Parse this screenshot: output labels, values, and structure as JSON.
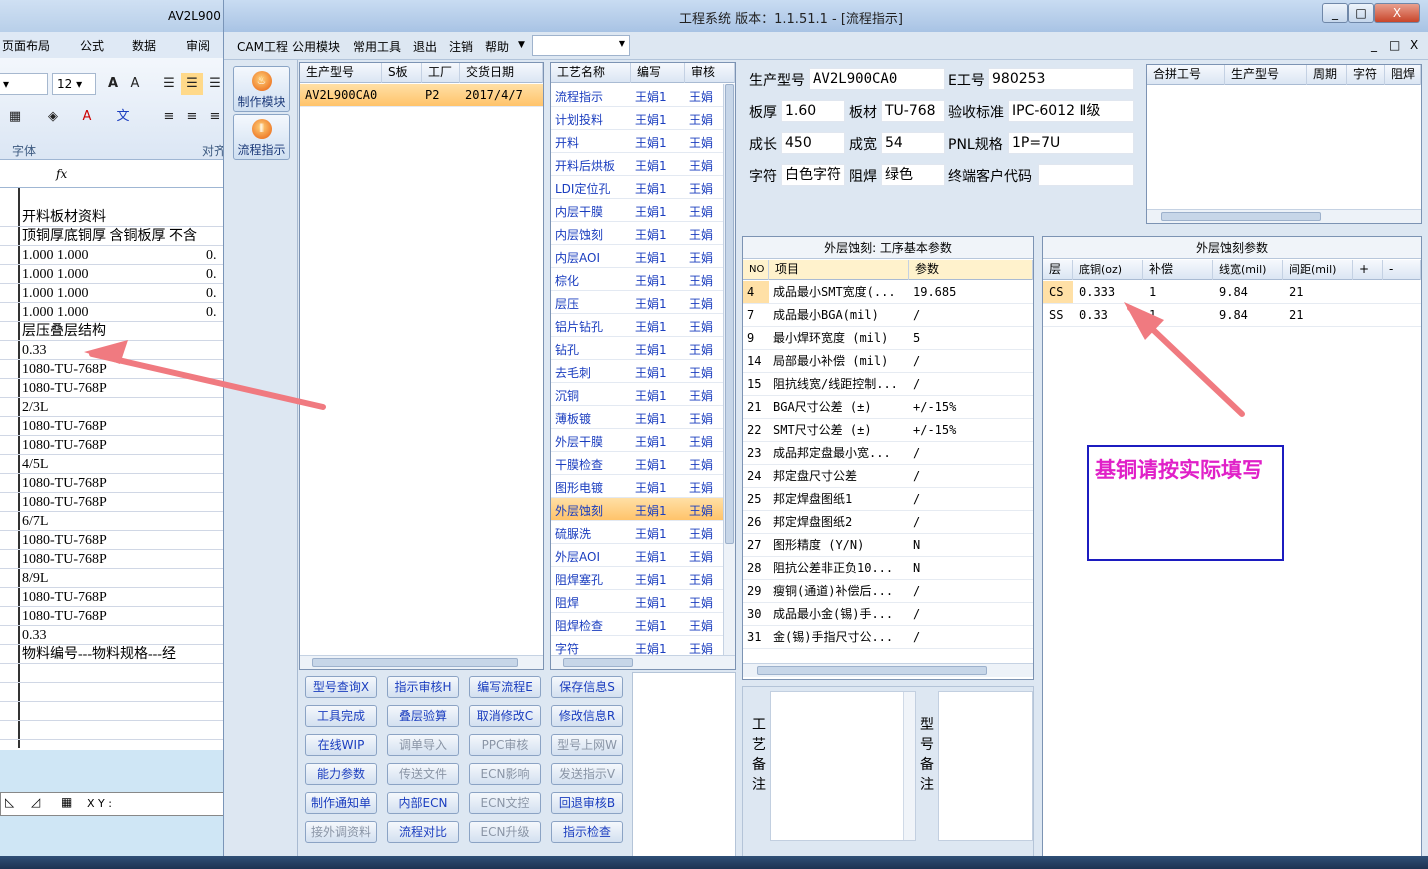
{
  "excel": {
    "title": "AV2L900",
    "tabs": [
      "页面布局",
      "公式",
      "数据",
      "审阅"
    ],
    "font_size": "12",
    "font_group": "字体",
    "align_group": "对齐",
    "fx": "fx",
    "rows": [
      "开料板材资料",
      "顶铜厚底铜厚 含铜板厚 不含",
      "1.000  1.000",
      "1.000  1.000",
      "1.000  1.000",
      "1.000  1.000",
      "层压叠层结构",
      "0.33",
      "1080-TU-768P",
      "1080-TU-768P",
      "2/3L",
      "1080-TU-768P",
      "1080-TU-768P",
      "4/5L",
      "1080-TU-768P",
      "1080-TU-768P",
      "6/7L",
      "1080-TU-768P",
      "1080-TU-768P",
      "8/9L",
      "1080-TU-768P",
      "1080-TU-768P",
      "0.33",
      "物料编号---物料规格---经"
    ],
    "row_suffix": [
      "",
      "",
      "0.",
      "0.",
      "0.",
      "0.",
      "",
      "",
      "",
      "",
      "",
      "",
      "",
      "",
      "",
      "",
      "",
      "",
      "",
      "",
      "",
      "",
      "",
      ""
    ],
    "xy_label": "X Y :"
  },
  "window": {
    "title": "工程系统   版本：1.1.51.1 - [流程指示]",
    "menus": [
      "CAM工程",
      "公用模块",
      "常用工具",
      "退出",
      "注销",
      "帮助"
    ],
    "min": "_",
    "restore": "□",
    "close": "X",
    "child_min": "_",
    "child_restore": "□",
    "child_close": "X"
  },
  "side_buttons": [
    {
      "label": "制作模块"
    },
    {
      "label": "流程指示"
    }
  ],
  "orders": {
    "headers": [
      "生产型号",
      "S板",
      "工厂",
      "交货日期"
    ],
    "rows": [
      {
        "model": "AV2L900CA0",
        "s": "",
        "factory": "P2",
        "date": "2017/4/7"
      }
    ]
  },
  "processes": {
    "headers": [
      "工艺名称",
      "编写",
      "审核"
    ],
    "rows": [
      [
        "流程指示",
        "王娟1",
        "王娟"
      ],
      [
        "计划投料",
        "王娟1",
        "王娟"
      ],
      [
        "开料",
        "王娟1",
        "王娟"
      ],
      [
        "开料后烘板",
        "王娟1",
        "王娟"
      ],
      [
        "LDI定位孔",
        "王娟1",
        "王娟"
      ],
      [
        "内层干膜",
        "王娟1",
        "王娟"
      ],
      [
        "内层蚀刻",
        "王娟1",
        "王娟"
      ],
      [
        "内层AOI",
        "王娟1",
        "王娟"
      ],
      [
        "棕化",
        "王娟1",
        "王娟"
      ],
      [
        "层压",
        "王娟1",
        "王娟"
      ],
      [
        "铝片钻孔",
        "王娟1",
        "王娟"
      ],
      [
        "钻孔",
        "王娟1",
        "王娟"
      ],
      [
        "去毛刺",
        "王娟1",
        "王娟"
      ],
      [
        "沉铜",
        "王娟1",
        "王娟"
      ],
      [
        "薄板镀",
        "王娟1",
        "王娟"
      ],
      [
        "外层干膜",
        "王娟1",
        "王娟"
      ],
      [
        "干膜检查",
        "王娟1",
        "王娟"
      ],
      [
        "图形电镀",
        "王娟1",
        "王娟"
      ],
      [
        "外层蚀刻",
        "王娟1",
        "王娟"
      ],
      [
        "硫脲洗",
        "王娟1",
        "王娟"
      ],
      [
        "外层AOI",
        "王娟1",
        "王娟"
      ],
      [
        "阻焊塞孔",
        "王娟1",
        "王娟"
      ],
      [
        "阻焊",
        "王娟1",
        "王娟"
      ],
      [
        "阻焊检查",
        "王娟1",
        "王娟"
      ],
      [
        "字符",
        "王娟1",
        "王娟"
      ]
    ],
    "selected_index": 18
  },
  "info": {
    "model_label": "生产型号",
    "model": "AV2L900CA0",
    "e_label": "E工号",
    "e": "980253",
    "thick_label": "板厚",
    "thick": "1.60",
    "mat_label": "板材",
    "mat": "TU-768",
    "std_label": "验收标准",
    "std": "IPC-6012 Ⅱ级",
    "len_label": "成长",
    "len": "450",
    "wid_label": "成宽",
    "wid": "54",
    "pnl_label": "PNL规格",
    "pnl": "1P=7U",
    "char_label": "字符",
    "char": "白色字符",
    "mask_label": "阻焊",
    "mask": "绿色",
    "cust_label": "终端客户代码",
    "cust": ""
  },
  "merge": {
    "headers": [
      "合拼工号",
      "生产型号",
      "周期",
      "字符",
      "阻焊"
    ]
  },
  "basic_params": {
    "title": "外层蚀刻: 工序基本参数",
    "headers": [
      "NO",
      "项目",
      "参数"
    ],
    "rows": [
      [
        "4",
        "成品最小SMT宽度(...",
        "19.685"
      ],
      [
        "7",
        "成品最小BGA(mil)",
        "/"
      ],
      [
        "9",
        "最小焊环宽度 (mil)",
        "5"
      ],
      [
        "14",
        "局部最小补偿 (mil)",
        "/"
      ],
      [
        "15",
        "阻抗线宽/线距控制...",
        "/"
      ],
      [
        "21",
        "BGA尺寸公差 (±)",
        "+/-15%"
      ],
      [
        "22",
        "SMT尺寸公差 (±)",
        "+/-15%"
      ],
      [
        "23",
        "成品邦定盘最小宽...",
        "/"
      ],
      [
        "24",
        "邦定盘尺寸公差",
        "/"
      ],
      [
        "25",
        "邦定焊盘图纸1",
        "/"
      ],
      [
        "26",
        "邦定焊盘图纸2",
        "/"
      ],
      [
        "27",
        "图形精度 (Y/N)",
        "N"
      ],
      [
        "28",
        "阻抗公差非正负10...",
        "N"
      ],
      [
        "29",
        "瘦铜(通道)补偿后...",
        "/"
      ],
      [
        "30",
        "成品最小金(锡)手...",
        "/"
      ],
      [
        "31",
        "金(锡)手指尺寸公...",
        "/"
      ]
    ]
  },
  "etch_params": {
    "title": "外层蚀刻参数",
    "headers": [
      "层",
      "底铜(oz)",
      "补偿",
      "线宽(mil)",
      "间距(mil)",
      "+",
      "-"
    ],
    "rows": [
      [
        "CS",
        "0.333",
        "1",
        "9.84",
        "21"
      ],
      [
        "SS",
        "0.33",
        "1",
        "9.84",
        "21"
      ]
    ]
  },
  "buttons": [
    {
      "label": "型号查询X",
      "enabled": true
    },
    {
      "label": "指示审核H",
      "enabled": true
    },
    {
      "label": "编写流程E",
      "enabled": true
    },
    {
      "label": "保存信息S",
      "enabled": true
    },
    {
      "label": "工具完成",
      "enabled": true
    },
    {
      "label": "叠层验算",
      "enabled": true
    },
    {
      "label": "取消修改C",
      "enabled": true
    },
    {
      "label": "修改信息R",
      "enabled": true
    },
    {
      "label": "在线WIP",
      "enabled": true
    },
    {
      "label": "调单导入",
      "enabled": false
    },
    {
      "label": "PPC审核",
      "enabled": false
    },
    {
      "label": "型号上网W",
      "enabled": false
    },
    {
      "label": "能力参数",
      "enabled": true
    },
    {
      "label": "传送文件",
      "enabled": false
    },
    {
      "label": "ECN影响",
      "enabled": false
    },
    {
      "label": "发送指示V",
      "enabled": false
    },
    {
      "label": "制作通知单",
      "enabled": true
    },
    {
      "label": "内部ECN",
      "enabled": true
    },
    {
      "label": "ECN文控",
      "enabled": false
    },
    {
      "label": "回退审核B",
      "enabled": true
    },
    {
      "label": "接外调资料",
      "enabled": false
    },
    {
      "label": "流程对比",
      "enabled": true
    },
    {
      "label": "ECN升级",
      "enabled": false
    },
    {
      "label": "指示检查",
      "enabled": true
    }
  ],
  "remarks": {
    "process": "工艺备注",
    "model": "型号备注"
  },
  "note": "基铜请按实际填写",
  "colors": {
    "annotation_arrow": "#f07a80",
    "note_text": "#e020c8",
    "note_border": "#1c1cc0",
    "link_blue": "#1a3dbf",
    "selected": "#ffc36a"
  }
}
